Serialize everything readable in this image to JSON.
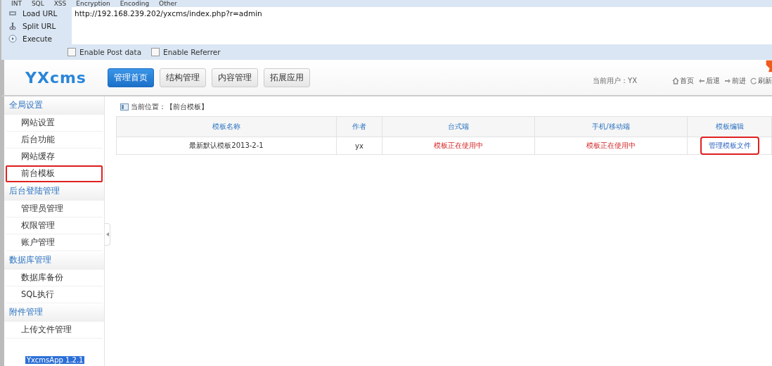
{
  "hackbar": {
    "menu": [
      "INT",
      "SQL",
      "XSS",
      "Encryption",
      "Encoding",
      "Other"
    ],
    "actions": [
      {
        "kind": "load",
        "label": "Load URL"
      },
      {
        "kind": "split",
        "label": "Split URL"
      },
      {
        "kind": "execute",
        "label": "Execute"
      }
    ],
    "url": "http://192.168.239.202/yxcms/index.php?r=admin",
    "options": [
      {
        "label": "Enable Post data",
        "checked": false
      },
      {
        "label": "Enable Referrer",
        "checked": false
      }
    ]
  },
  "header": {
    "logo": "YXcms",
    "nav": [
      {
        "label": "管理首页",
        "selected": true
      },
      {
        "label": "结构管理",
        "selected": false
      },
      {
        "label": "内容管理",
        "selected": false
      },
      {
        "label": "拓展应用",
        "selected": false
      }
    ],
    "current_user": "当前用户：YX",
    "links": [
      {
        "kind": "home",
        "label": "首页"
      },
      {
        "kind": "back",
        "label": "后退"
      },
      {
        "kind": "forward",
        "label": "前进"
      },
      {
        "kind": "refresh",
        "label": "刷新"
      }
    ]
  },
  "sidebar": {
    "groups": [
      {
        "title": "全局设置",
        "items": [
          {
            "label": "网站设置",
            "highlighted": false
          },
          {
            "label": "后台功能",
            "highlighted": false
          },
          {
            "label": "网站缓存",
            "highlighted": false
          },
          {
            "label": "前台模板",
            "highlighted": true
          }
        ]
      },
      {
        "title": "后台登陆管理",
        "items": [
          {
            "label": "管理员管理",
            "highlighted": false
          },
          {
            "label": "权限管理",
            "highlighted": false
          },
          {
            "label": "账户管理",
            "highlighted": false
          }
        ]
      },
      {
        "title": "数据库管理",
        "items": [
          {
            "label": "数据库备份",
            "highlighted": false
          },
          {
            "label": "SQL执行",
            "highlighted": false
          }
        ]
      },
      {
        "title": "附件管理",
        "items": [
          {
            "label": "上传文件管理",
            "highlighted": false
          }
        ]
      }
    ],
    "version": "YxcmsApp 1.2.1"
  },
  "breadcrumb": "当前位置：【前台模板】",
  "table": {
    "columns": [
      "模板名称",
      "作者",
      "台式端",
      "手机/移动端",
      "模板编辑"
    ],
    "rows": [
      {
        "name": "最新默认模板2013-2-1",
        "author": "yx",
        "desktop": "模板正在使用中",
        "mobile": "模板正在使用中",
        "edit": "管理模板文件",
        "edit_highlighted": true
      }
    ]
  }
}
